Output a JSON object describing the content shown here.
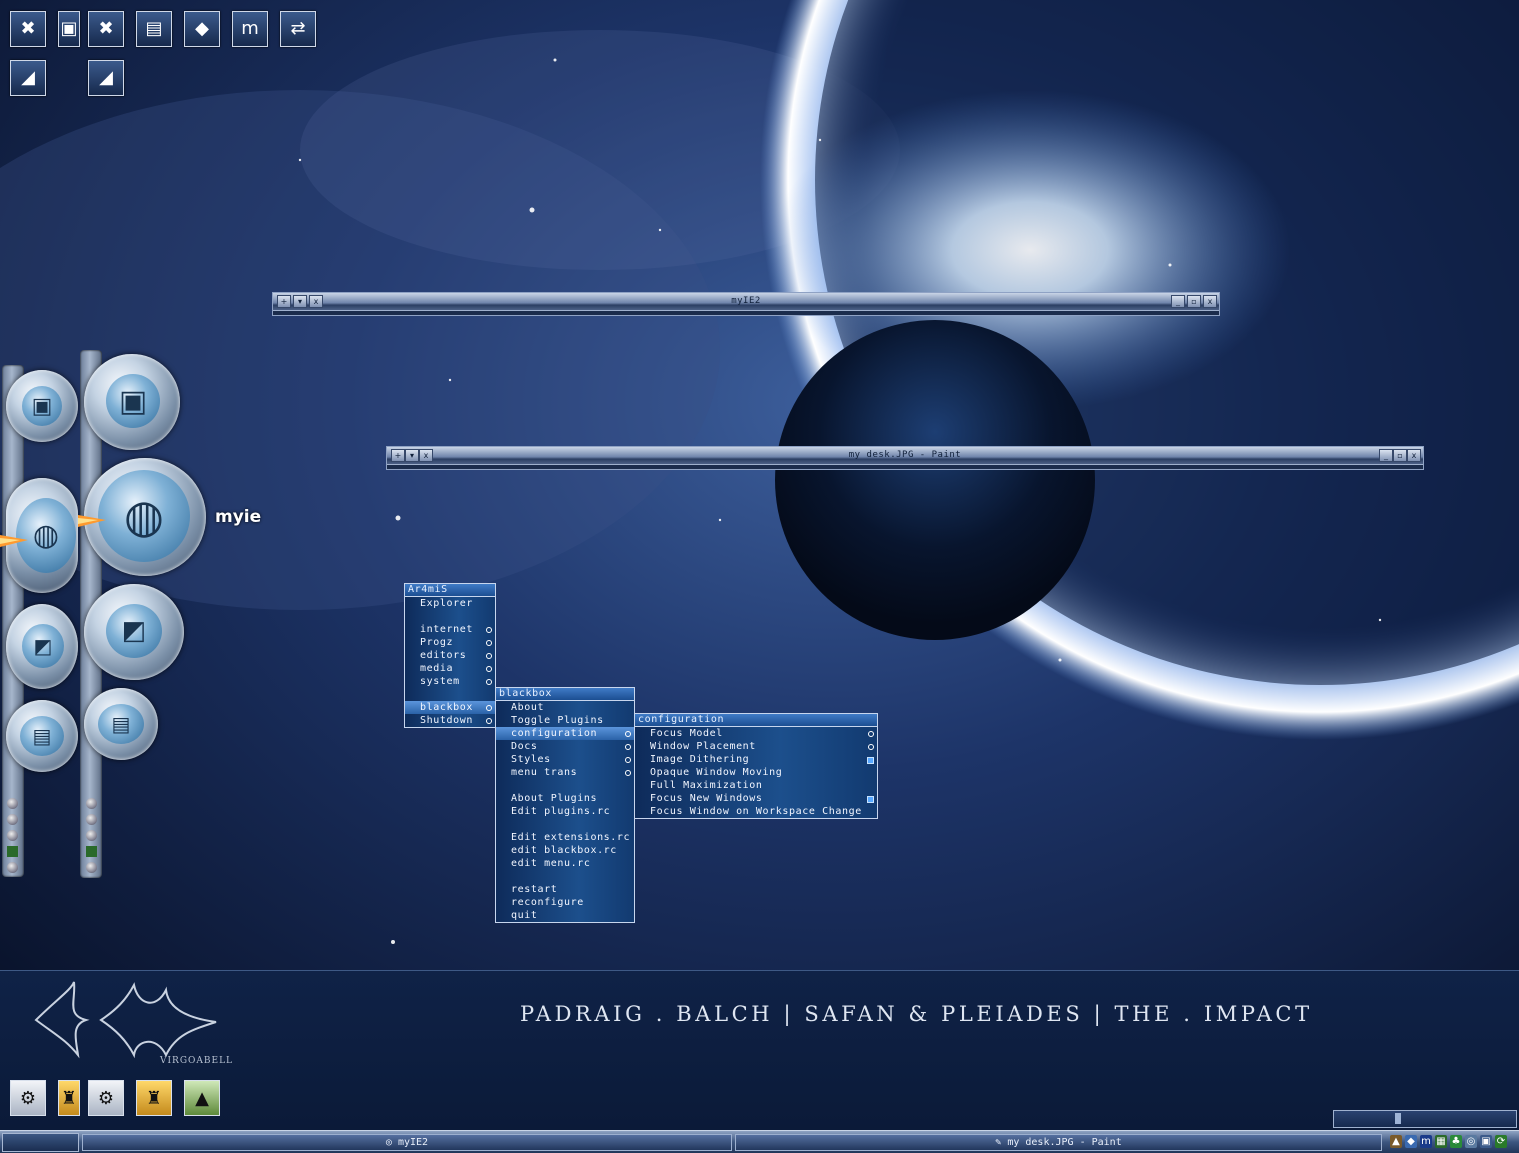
{
  "desktop": {
    "top_icons": [
      {
        "name": "xfire-icon",
        "glyph": "✖"
      },
      {
        "name": "my-computer-icon",
        "glyph": "▣"
      },
      {
        "name": "xfire-icon-2",
        "glyph": "✖"
      },
      {
        "name": "network-icon",
        "glyph": "▤"
      },
      {
        "name": "stone-icon",
        "glyph": "◆"
      },
      {
        "name": "maxthon-icon",
        "glyph": "m"
      },
      {
        "name": "sync-icon",
        "glyph": "⇄"
      },
      {
        "name": "dolphin-icon",
        "glyph": "◢"
      },
      {
        "name": "dolphin-icon-2",
        "glyph": "◢"
      }
    ],
    "dock_hover_label": "myie"
  },
  "windows": {
    "myie2": {
      "title": "myIE2",
      "buttons": [
        "+",
        "▾",
        "x",
        "_",
        "▫",
        "x"
      ]
    },
    "paint": {
      "title": "my desk.JPG - Paint",
      "buttons": [
        "+",
        "▾",
        "x",
        "_",
        "▫",
        "x"
      ]
    }
  },
  "menus": {
    "root": {
      "title": "Ar4miS",
      "items": [
        {
          "label": "Explorer",
          "type": "item"
        },
        {
          "label": "",
          "type": "gap"
        },
        {
          "label": "internet",
          "type": "sub"
        },
        {
          "label": "Progz",
          "type": "sub"
        },
        {
          "label": "editors",
          "type": "sub"
        },
        {
          "label": "media",
          "type": "sub"
        },
        {
          "label": "system",
          "type": "sub"
        },
        {
          "label": "",
          "type": "gap"
        },
        {
          "label": "blackbox",
          "type": "sub",
          "selected": true
        },
        {
          "label": "Shutdown",
          "type": "sub"
        }
      ]
    },
    "blackbox": {
      "title": "blackbox",
      "items": [
        {
          "label": "About",
          "type": "item"
        },
        {
          "label": "Toggle Plugins",
          "type": "item"
        },
        {
          "label": "configuration",
          "type": "sub",
          "selected": true
        },
        {
          "label": "Docs",
          "type": "sub"
        },
        {
          "label": "Styles",
          "type": "sub"
        },
        {
          "label": "menu trans",
          "type": "sub"
        },
        {
          "label": "",
          "type": "gap"
        },
        {
          "label": "About Plugins",
          "type": "item"
        },
        {
          "label": "Edit plugins.rc",
          "type": "item"
        },
        {
          "label": "",
          "type": "gap"
        },
        {
          "label": "Edit extensions.rc",
          "type": "item"
        },
        {
          "label": "edit blackbox.rc",
          "type": "item"
        },
        {
          "label": "edit menu.rc",
          "type": "item"
        },
        {
          "label": "",
          "type": "gap"
        },
        {
          "label": "restart",
          "type": "item"
        },
        {
          "label": "reconfigure",
          "type": "item"
        },
        {
          "label": "quit",
          "type": "item"
        }
      ]
    },
    "configuration": {
      "title": "configuration",
      "items": [
        {
          "label": "Focus Model",
          "type": "sub"
        },
        {
          "label": "Window Placement",
          "type": "sub"
        },
        {
          "label": "Image Dithering",
          "type": "check",
          "checked": true
        },
        {
          "label": "Opaque Window Moving",
          "type": "item"
        },
        {
          "label": "Full Maximization",
          "type": "item"
        },
        {
          "label": "Focus New Windows",
          "type": "check",
          "checked": true
        },
        {
          "label": "Focus Window on Workspace Change",
          "type": "item"
        }
      ]
    }
  },
  "bottom_panel": {
    "credits": "PADRAIG . BALCH  |  SAFAN & PLEIADES  |  THE . IMPACT",
    "signature": "VIRGOABELL",
    "quick_launch": [
      {
        "name": "steam-icon",
        "glyph": "⚙"
      },
      {
        "name": "counter-strike-icon",
        "glyph": "♜"
      },
      {
        "name": "steam-icon-2",
        "glyph": "⚙"
      },
      {
        "name": "counter-strike-icon-2",
        "glyph": "♜"
      },
      {
        "name": "illuminati-icon",
        "glyph": "▲"
      }
    ]
  },
  "taskbar": {
    "tasks": [
      {
        "label": "myIE2",
        "icon": "◎"
      },
      {
        "label": "my desk.JPG - Paint",
        "icon": "✎"
      }
    ],
    "tray": [
      "▲",
      "◆",
      "m",
      "▦",
      "♣",
      "◎",
      "▣",
      "⟳"
    ],
    "volume_level": 0.35
  },
  "colors": {
    "menu_bg": "#1c4f8c",
    "menu_highlight": "#2a62a8",
    "titlebar": "#6f84ab",
    "taskbar": "#3d5680"
  }
}
